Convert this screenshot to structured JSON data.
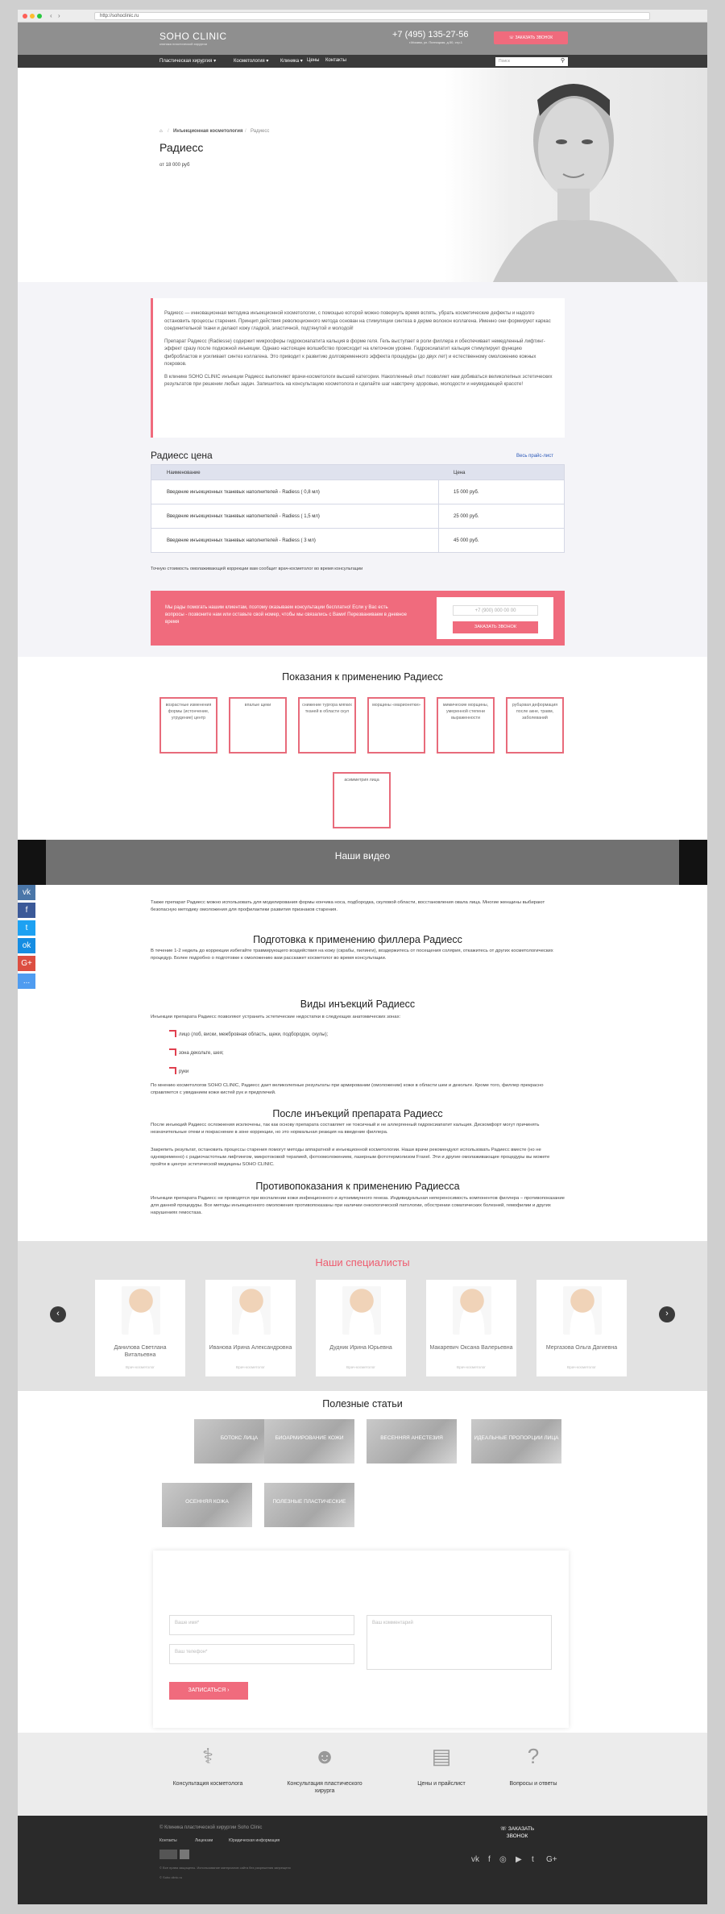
{
  "browser": {
    "url": "http://sohoclinic.ru",
    "back": "‹",
    "forward": "›"
  },
  "header": {
    "logo": "SOHO CLINIC",
    "logo_sub": "клиника пластической хирургии",
    "phone": "+7 (495) 135-27-56",
    "address": "г.Москва, ул. Пятницкая, д.50, стр.1",
    "order_button": "ЗАКАЗАТЬ ЗВОНОК"
  },
  "menu": {
    "items": [
      "Пластическая хирургия",
      "Косметология",
      "Клиника",
      "Цены",
      "Контакты"
    ],
    "search_placeholder": "Поиск"
  },
  "breadcrumb": {
    "home": "⌂",
    "section": "Инъекционная косметология",
    "current": "Радиесс"
  },
  "hero": {
    "title": "Радиесс",
    "price": "от 18 000 руб"
  },
  "intro": [
    "Радиесс — инновационная методика инъекционной косметологии, с помощью которой можно повернуть время вспять, убрать косметические дефекты и надолго остановить процессы старения. Принцип действия революционного метода основан на стимуляции синтеза в дерме волокон коллагена. Именно они формируют каркас соединительной ткани и делают кожу гладкой, эластичной, подтянутой и молодой!",
    "Препарат Радиесс (Radiesse) содержит микросферы гидроксиапатита кальция в форме геля. Гель выступает в роли филлера и обеспечивает немедленный лифтинг-эффект сразу после подкожной инъекции. Однако настоящее волшебство происходит на клеточном уровне. Гидроксиапатит кальция стимулирует функцию фибробластов и усиливает синтез коллагена. Это приводит к развитию долговременного эффекта процедуры (до двух лет) и естественному омоложению кожных покровов.",
    "В клинике SOHO CLINIC инъекции Радиесс выполняют врачи-косметологи высшей категории. Накопленный опыт позволяет нам добиваться великолепных эстетических результатов при решении любых задач. Запишитесь на консультацию косметолога и сделайте шаг навстречу здоровью, молодости и неувядающей красоте!"
  ],
  "prices": {
    "title": "Радиесс цена",
    "link": "Весь прайс-лист",
    "col_name": "Наименование",
    "col_price": "Цена",
    "rows": [
      {
        "name": "Введение инъекционных тканевых наполнителей - Radiess ( 0,8 мл)",
        "price": "15 000 руб."
      },
      {
        "name": "Введение инъекционных тканевых наполнителей - Radiess ( 1,5 мл)",
        "price": "25 000 руб."
      },
      {
        "name": "Введение инъекционных тканевых наполнителей - Radiess ( 3 мл)",
        "price": "45 000 руб."
      }
    ],
    "note": "Точную стоимость омолаживающей коррекции вам сообщит врач-косметолог во время консультации"
  },
  "consult": {
    "text": "Мы рады помогать нашим клиентам, поэтому оказываем консультации бесплатно! Если у Вас есть вопросы - позвоните нам или оставьте свой номер, чтобы мы связались с Вами! Перезваниваем в дневное время",
    "phone_placeholder": "+7 (900) 000 00 00",
    "button": "ЗАКАЗАТЬ ЗВОНОК"
  },
  "indications": {
    "title": "Показания к применению Радиесс",
    "items": [
      "возрастные изменения формы (истончение, угрудение) центр",
      "впалые щеки",
      "снижение тургора мягких тканей в области скул",
      "морщины «марионетки»",
      "мимические морщины, умеренной степени выраженности",
      "рубцовая деформация после акне, травм, заболеваний",
      "асимметрия лица"
    ]
  },
  "video": {
    "title": "Наши видео"
  },
  "social": [
    "vk",
    "f",
    "t",
    "ok",
    "G+",
    "..."
  ],
  "article": {
    "p1": "Также препарат Радиесс можно использовать для моделирования формы кончика носа, подбородка, скуловой области, восстановления овала лица. Многие женщины выбирают безопасную методику омоложения для профилактики развития признаков старения.",
    "h_prep": "Подготовка к применению филлера Радиесс",
    "p_prep": "В течение 1-2 недель до коррекции избегайте травмирующего воздействия на кожу (скрабы, пилинги), воздержитесь от посещения солярия, откажитесь от других косметологических процедур. Более подробно о подготовке к омоложению вам расскажет косметолог во время консультации.",
    "h_types": "Виды инъекций Радиесс",
    "p_types": "Инъекции препарата Радиесс позволяют устранить эстетические недостатки в следующих анатомических зонах:",
    "zones": [
      "лицо (лоб, виски, межбровная область, щеки, подбородок, скулы);",
      "зона декольте, шея;",
      "руки"
    ],
    "p_types2": "По мнению косметологов SOHO CLINIC, Радиесс дает великолепные результаты при армировании (омоложении) кожи в области шеи и декольте. Кроме того, филлер прекрасно справляется с увяданием кожи кистей рук и предплечий.",
    "h_after": "После инъекций препарата Радиесс",
    "p_after1": "После инъекций Радиесс осложнения исключены, так как основу препарата составляет не токсичный и не аллергенный гидроксиапатит кальция. Дискомфорт могут причинять незначительные отеки и покраснение в зоне коррекции, но это нормальная реакция на введение филлера.",
    "p_after2": "Закрепить результат, остановить процессы старения помогут методы аппаратной и инъекционной косметологии. Наши врачи рекомендуют использовать Радиесс вместе (но не одновременно) с радиочастотным лифтингом, микротоковой терапией, фотоомоложением, лазерным фототермолизом Fraxel. Эти и другие омолаживающие процедуры вы можете пройти в центре эстетической медицины SOHO CLINIC.",
    "h_contra": "Противопоказания к применению Радиесса",
    "p_contra": "Инъекции препарата Радиесс не проводятся при воспалении кожи инфекционного и аутоиммунного генеза. Индивидуальная непереносимость компонентов филлера – противопоказание для данной процедуры. Все методы инъекционного омоложения противопоказаны при наличии онкологической патологии, обострении соматических болезней, гемофилии и других нарушениях гемостаза."
  },
  "specialists": {
    "title": "Наши специалисты",
    "prev": "‹",
    "next": "›",
    "items": [
      {
        "name": "Данилова Светлана Витальевна",
        "role": "Врач-косметолог"
      },
      {
        "name": "Иванова Ирина Александровна",
        "role": "Врач-косметолог"
      },
      {
        "name": "Дудник Ирина Юрьевна",
        "role": "Врач-косметолог"
      },
      {
        "name": "Макаревич Оксана Валерьевна",
        "role": "Врач-косметолог"
      },
      {
        "name": "Мергазова Ольга Дагиевна",
        "role": "Врач-косметолог"
      }
    ]
  },
  "articles": {
    "title": "Полезные статьи",
    "items": [
      "БОТОКС ЛИЦА",
      "БИОАРМИРОВАНИЕ КОЖИ",
      "ВЕСЕННЯЯ АНЕСТЕЗИЯ",
      "ИДЕАЛЬНЫЕ ПРОПОРЦИИ ЛИЦА",
      "ОСЕННЯЯ КОЖА",
      "ПОЛЕЗНЫЕ ПЛАСТИЧЕСКИЕ"
    ]
  },
  "form": {
    "name_placeholder": "Ваше имя*",
    "phone_placeholder": "Ваш телефон*",
    "comment_placeholder": "Ваш комментарий",
    "button": "ЗАПИСАТЬСЯ"
  },
  "features": [
    {
      "icon": "⚕",
      "label": "Консультация косметолога"
    },
    {
      "icon": "☻",
      "label": "Консультация пластического хирурга"
    },
    {
      "icon": "▤",
      "label": "Цены и прайслист"
    },
    {
      "icon": "?",
      "label": "Вопросы и ответы"
    }
  ],
  "footer": {
    "copyright": "© Клиника пластической хирургии Soho Clinic",
    "links": [
      "Контакты",
      "Лицензии",
      "Юридическая информация"
    ],
    "order": "ЗАКАЗАТЬ ЗВОНОК",
    "social": [
      "vk",
      "f",
      "◎",
      "▶",
      "t",
      "G+"
    ],
    "small1": "© Все права защищены. Использование материалов сайта без разрешения запрещено",
    "small2": "© Soho clinic.ru"
  },
  "colors": {
    "accent": "#f06b7d",
    "header": "#8f8f8f",
    "menu": "#3a3a3a",
    "footer": "#2a2a2a"
  }
}
